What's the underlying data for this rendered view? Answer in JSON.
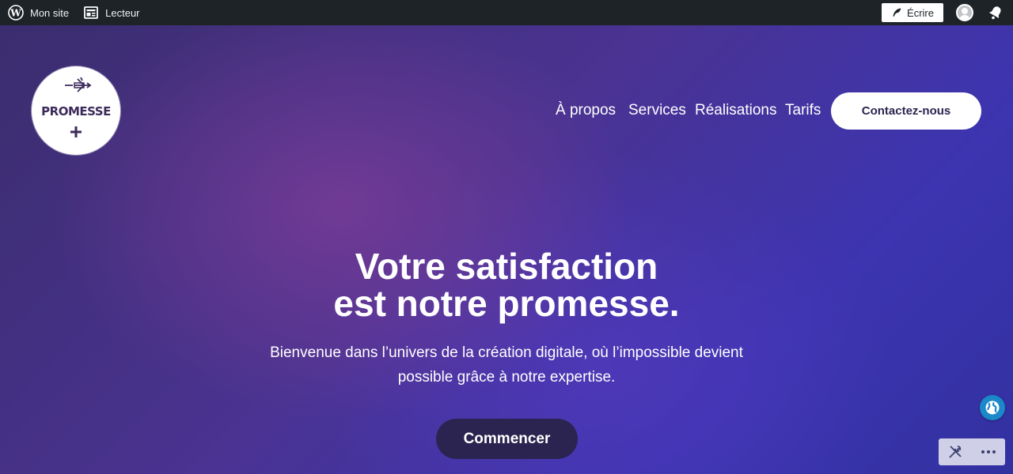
{
  "adminbar": {
    "my_site": "Mon site",
    "reader": "Lecteur",
    "write": "Écrire"
  },
  "logo": {
    "text": "PROMESSE"
  },
  "nav": {
    "items": [
      {
        "label": "À propos"
      },
      {
        "label": "Services"
      },
      {
        "label": "Réalisations"
      },
      {
        "label": "Tarifs"
      }
    ],
    "contact": "Contactez-nous"
  },
  "hero": {
    "headline_line1": "Votre satisfaction",
    "headline_line2": "est notre promesse.",
    "subtitle_line1": "Bienvenue dans l’univers de la création digitale, où l’impossible devient",
    "subtitle_line2": "possible grâce à notre expertise.",
    "cta": "Commencer"
  },
  "icons": {
    "wordpress": "wordpress-icon",
    "reader": "reader-icon",
    "write": "feather-icon",
    "avatar": "avatar-icon",
    "notifications": "bell-icon",
    "translate": "globe-icon",
    "tools": "tools-icon",
    "more": "more-icon"
  },
  "colors": {
    "adminbar": "#1d2327",
    "cta_bg": "#2b2450",
    "globe": "#1a88c9"
  }
}
